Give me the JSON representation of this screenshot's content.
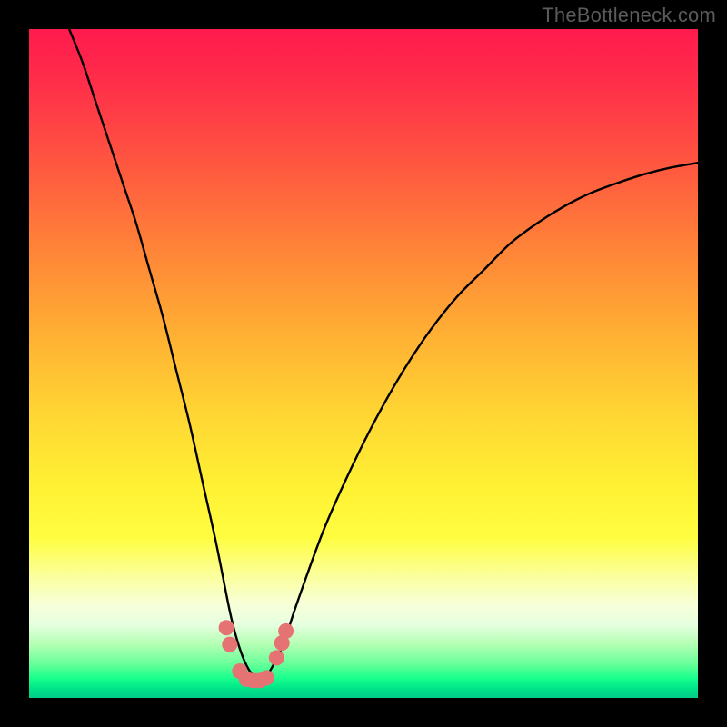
{
  "watermark": "TheBottleneck.com",
  "chart_data": {
    "type": "line",
    "title": "",
    "xlabel": "",
    "ylabel": "",
    "xlim": [
      0,
      100
    ],
    "ylim": [
      0,
      100
    ],
    "series": [
      {
        "name": "bottleneck-curve",
        "x": [
          6,
          8,
          10,
          12,
          14,
          16,
          18,
          20,
          22,
          24,
          26,
          28,
          30,
          31,
          32,
          33,
          34,
          35,
          36,
          38,
          40,
          44,
          48,
          52,
          56,
          60,
          64,
          68,
          72,
          76,
          80,
          84,
          88,
          92,
          96,
          100
        ],
        "y": [
          100,
          95,
          89,
          83,
          77,
          71,
          64,
          57,
          49,
          41,
          32,
          23,
          13,
          9,
          6,
          4,
          3,
          3,
          4,
          8,
          14,
          25,
          34,
          42,
          49,
          55,
          60,
          64,
          68,
          71,
          73.5,
          75.5,
          77,
          78.3,
          79.3,
          80
        ]
      }
    ],
    "markers": {
      "name": "highlight-dots",
      "color": "#e57373",
      "points": [
        {
          "x": 29.5,
          "y": 10.5
        },
        {
          "x": 30.0,
          "y": 8.0
        },
        {
          "x": 31.5,
          "y": 4.0
        },
        {
          "x": 32.5,
          "y": 2.8
        },
        {
          "x": 33.5,
          "y": 2.6
        },
        {
          "x": 34.5,
          "y": 2.6
        },
        {
          "x": 35.5,
          "y": 3.0
        },
        {
          "x": 37.0,
          "y": 6.0
        },
        {
          "x": 37.8,
          "y": 8.2
        },
        {
          "x": 38.4,
          "y": 10.0
        }
      ]
    },
    "gradient_stops": [
      {
        "pos": 0.0,
        "color": "#ff1a4d"
      },
      {
        "pos": 0.33,
        "color": "#ff8438"
      },
      {
        "pos": 0.68,
        "color": "#fff033"
      },
      {
        "pos": 0.92,
        "color": "#b3ffb3"
      },
      {
        "pos": 1.0,
        "color": "#00cc88"
      }
    ]
  }
}
